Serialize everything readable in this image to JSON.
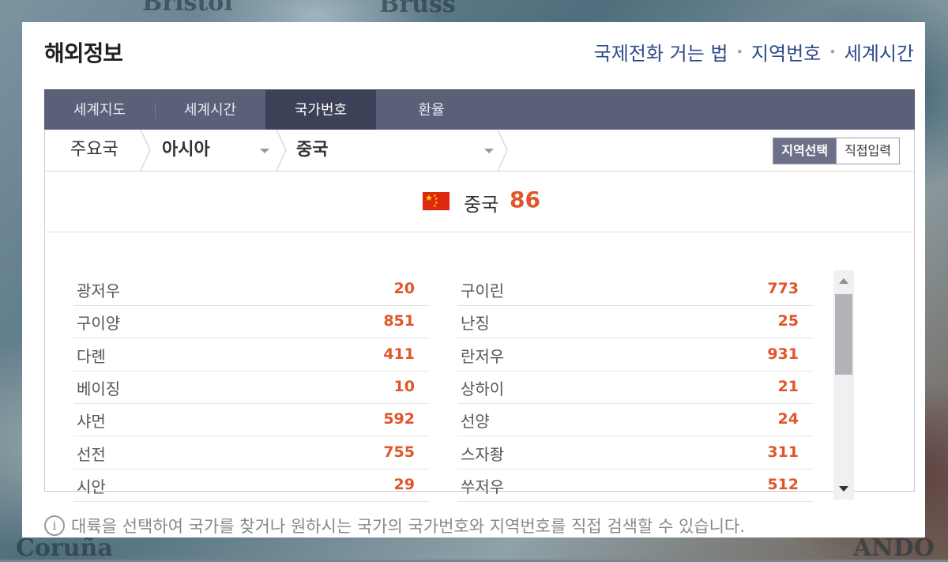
{
  "header": {
    "title": "해외정보",
    "links": [
      "국제전화 거는 법",
      "지역번호",
      "세계시간"
    ]
  },
  "tabs": [
    "세계지도",
    "세계시간",
    "국가번호",
    "환율"
  ],
  "active_tab": "국가번호",
  "breadcrumb": {
    "level1": "주요국",
    "level2": "아시아",
    "level3": "중국"
  },
  "toggle": {
    "region_select": "지역선택",
    "direct_input": "직접입력"
  },
  "country": {
    "name": "중국",
    "code": "86"
  },
  "regions_left": [
    {
      "name": "광저우",
      "code": "20"
    },
    {
      "name": "구이양",
      "code": "851"
    },
    {
      "name": "다롄",
      "code": "411"
    },
    {
      "name": "베이징",
      "code": "10"
    },
    {
      "name": "샤먼",
      "code": "592"
    },
    {
      "name": "선전",
      "code": "755"
    },
    {
      "name": "시안",
      "code": "29"
    }
  ],
  "regions_right": [
    {
      "name": "구이린",
      "code": "773"
    },
    {
      "name": "난징",
      "code": "25"
    },
    {
      "name": "란저우",
      "code": "931"
    },
    {
      "name": "상하이",
      "code": "21"
    },
    {
      "name": "선양",
      "code": "24"
    },
    {
      "name": "스자좡",
      "code": "311"
    },
    {
      "name": "쑤저우",
      "code": "512"
    }
  ],
  "info_text": "대륙을 선택하여 국가를 찾거나 원하시는 국가의 국가번호와 지역번호를 직접 검색할 수 있습니다.",
  "colors": {
    "accent": "#e0562a",
    "tab_bg": "#5b5f78",
    "tab_active": "#3d4157",
    "link": "#2f4a8a"
  }
}
